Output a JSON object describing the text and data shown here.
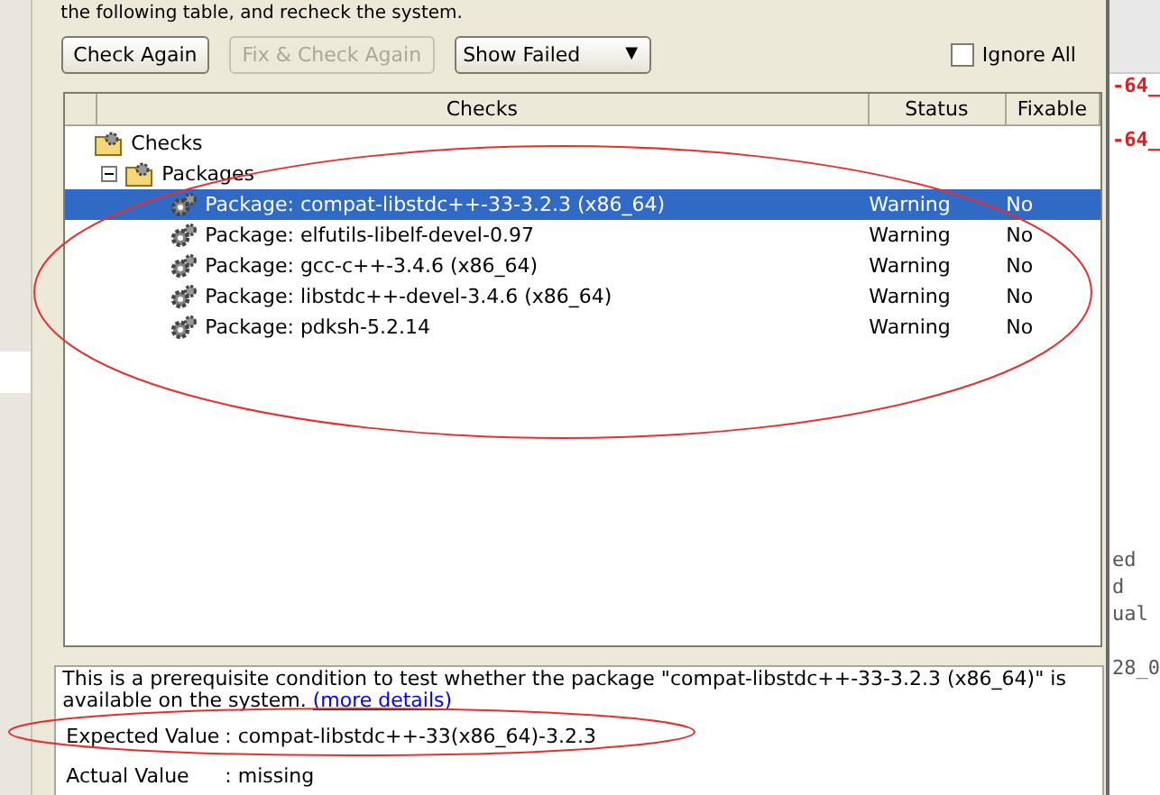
{
  "instruction": "the following table, and recheck the system.",
  "toolbar": {
    "check_again": "Check Again",
    "fix_check_again": {
      "label": "Fix & Check Again",
      "disabled": true
    },
    "filter": "Show Failed",
    "filter_arrow": "▼",
    "ignore_all": {
      "label": "Ignore All",
      "checked": false
    }
  },
  "table": {
    "columns": [
      "Checks",
      "Status",
      "Fixable"
    ],
    "tree": {
      "label": "Checks",
      "children": [
        {
          "label": "Packages",
          "expanded": true,
          "children": [
            {
              "label": "Package: compat-libstdc++-33-3.2.3 (x86_64)",
              "status": "Warning",
              "fixable": "No",
              "selected": true
            },
            {
              "label": "Package: elfutils-libelf-devel-0.97",
              "status": "Warning",
              "fixable": "No",
              "selected": false
            },
            {
              "label": "Package: gcc-c++-3.4.6 (x86_64)",
              "status": "Warning",
              "fixable": "No",
              "selected": false
            },
            {
              "label": "Package: libstdc++-devel-3.4.6 (x86_64)",
              "status": "Warning",
              "fixable": "No",
              "selected": false
            },
            {
              "label": "Package: pdksh-5.2.14",
              "status": "Warning",
              "fixable": "No",
              "selected": false
            }
          ]
        }
      ]
    }
  },
  "details": {
    "description": "This is a prerequisite condition to test whether the package \"compat-libstdc++-33-3.2.3 (x86_64)\" is available on the system.",
    "link": "(more details)",
    "expected_label": "Expected Value",
    "expected_value": ": compat-libstdc++-33(x86_64)-3.2.3",
    "actual_label": "Actual Value",
    "actual_value": ": missing"
  },
  "background_window": {
    "red_lines": [
      "-64_",
      "-64_"
    ],
    "gray_lines": [
      "ed",
      "d",
      "ual",
      "28_0"
    ]
  }
}
